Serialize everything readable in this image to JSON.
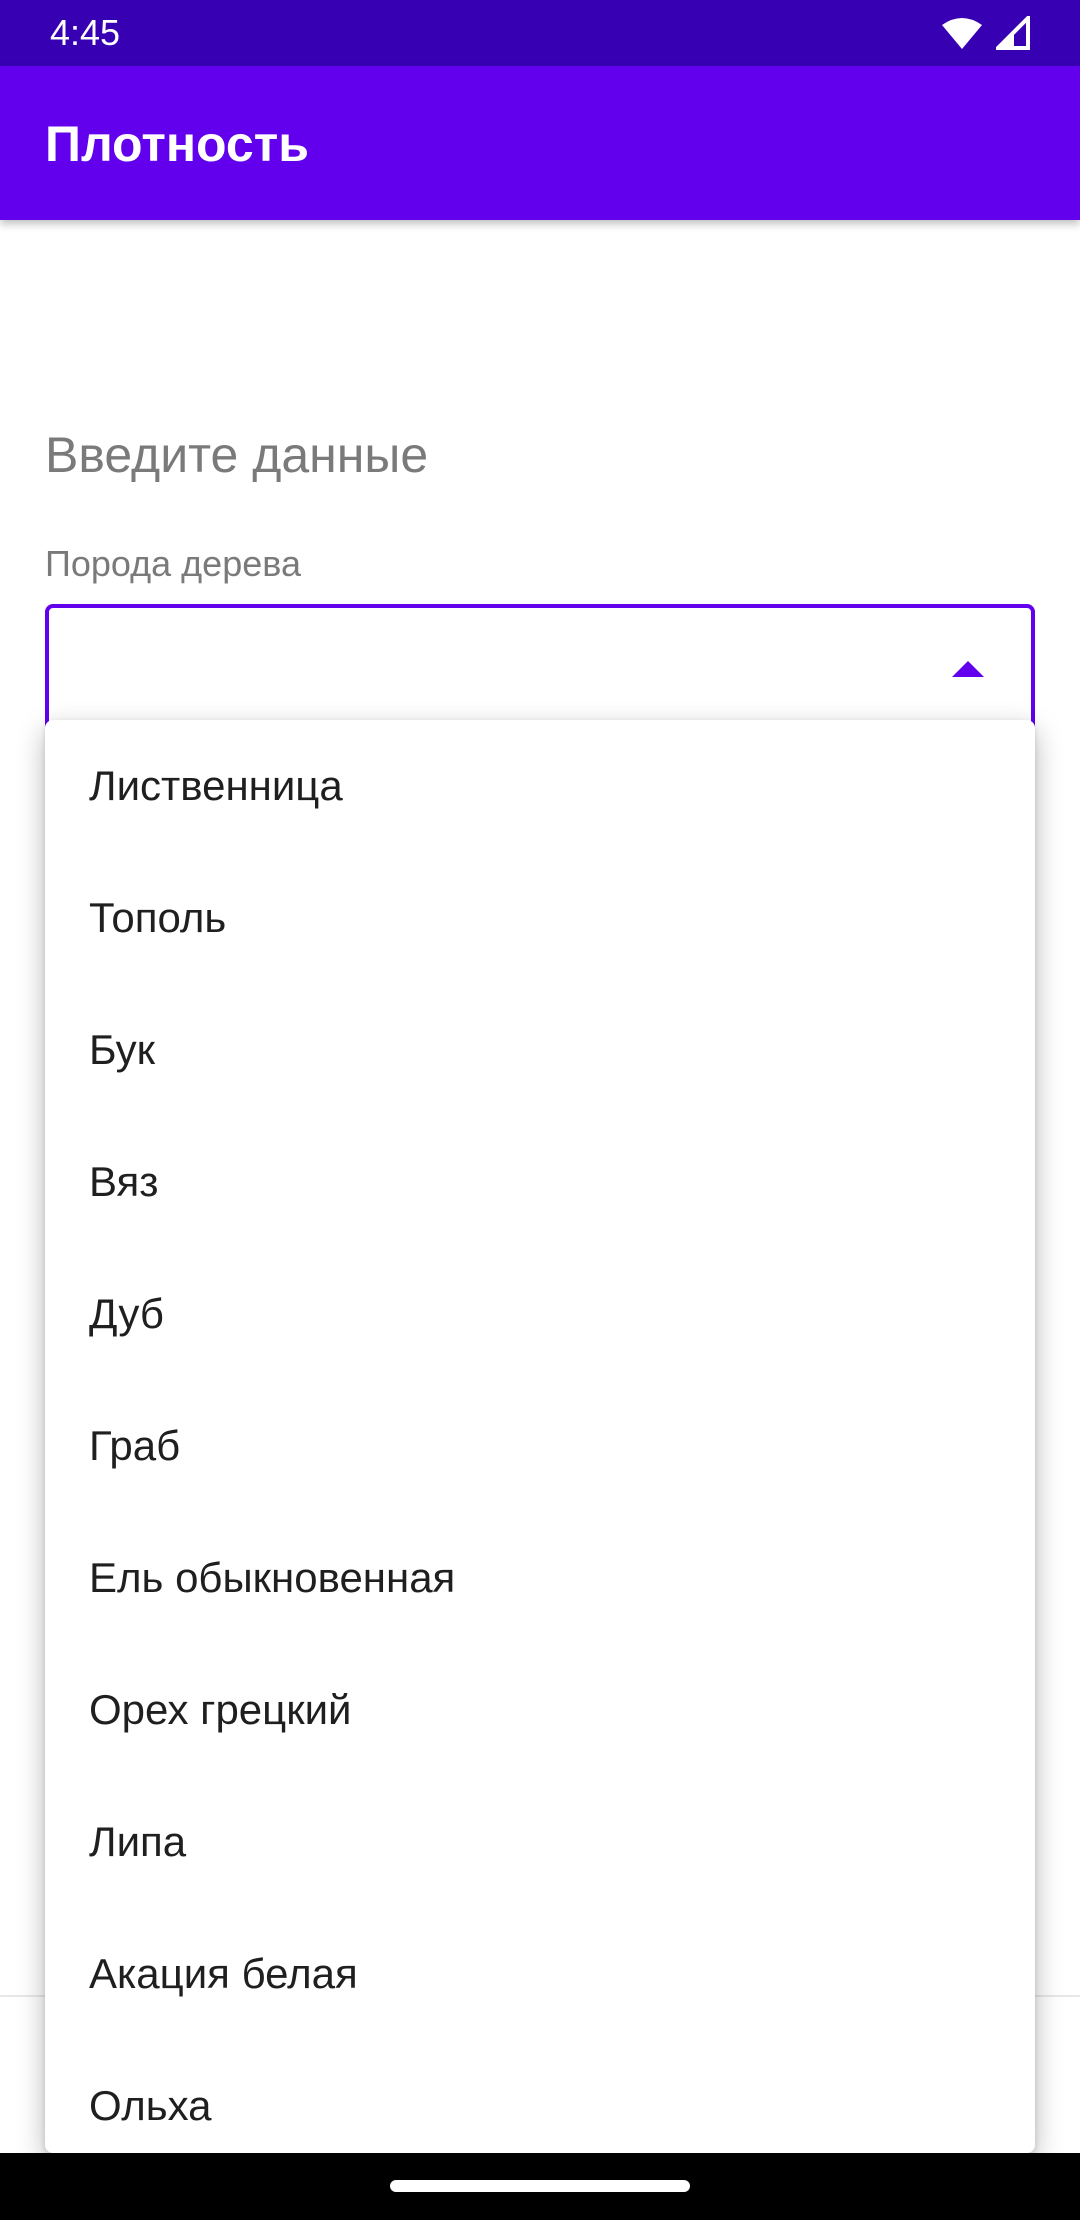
{
  "status_bar": {
    "time": "4:45"
  },
  "app_bar": {
    "title": "Плотность"
  },
  "form": {
    "section_title": "Введите данные",
    "field_label": "Порода дерева",
    "selected_value": ""
  },
  "dropdown": {
    "options": [
      "Лиственница",
      "Тополь",
      "Бук",
      "Вяз",
      "Дуб",
      "Граб",
      "Ель обыкновенная",
      "Орех грецкий",
      "Липа",
      "Акация белая",
      "Ольха"
    ]
  },
  "colors": {
    "status_bar": "#3700b3",
    "primary": "#6200ee",
    "secondary_text": "#7a7a7a"
  },
  "icons": [
    "wifi-icon",
    "cell-signal-icon",
    "dropdown-arrow-icon"
  ]
}
